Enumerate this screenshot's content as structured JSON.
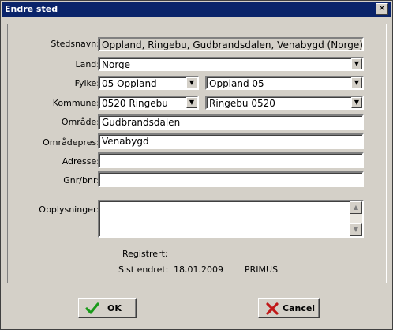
{
  "window": {
    "title": "Endre sted",
    "close_glyph": "✕"
  },
  "form": {
    "stedsnavn": {
      "label": "Stedsnavn:",
      "value": "Oppland, Ringebu, Gudbrandsdalen, Venabygd (Norge)"
    },
    "land": {
      "label": "Land:",
      "value": "Norge"
    },
    "fylke": {
      "label": "Fylke:",
      "value1": "05  Oppland",
      "value2": "Oppland  05"
    },
    "kommune": {
      "label": "Kommune:",
      "value1": "0520  Ringebu",
      "value2": "Ringebu  0520"
    },
    "omrade": {
      "label": "Område:",
      "value": "Gudbrandsdalen"
    },
    "omradepres": {
      "label": "Områdepres:",
      "value": "Venabygd"
    },
    "adresse": {
      "label": "Adresse:",
      "value": ""
    },
    "gnrbnr": {
      "label": "Gnr/bnr:",
      "value": ""
    },
    "opplysninger": {
      "label": "Opplysninger:",
      "value": ""
    }
  },
  "meta": {
    "registrert_label": "Registrert:",
    "registrert_value": "",
    "sist_endret_label": "Sist endret:",
    "sist_endret_date": "18.01.2009",
    "sist_endret_user": "PRIMUS"
  },
  "buttons": {
    "ok": "OK",
    "cancel": "Cancel"
  },
  "icons": {
    "ok": "check-icon",
    "cancel": "x-icon",
    "dropdown": "chevron-down-icon"
  },
  "colors": {
    "titlebar": "#0a246a",
    "face": "#d4d0c8",
    "ok_icon": "#1a9a1a",
    "cancel_icon": "#c01818"
  }
}
